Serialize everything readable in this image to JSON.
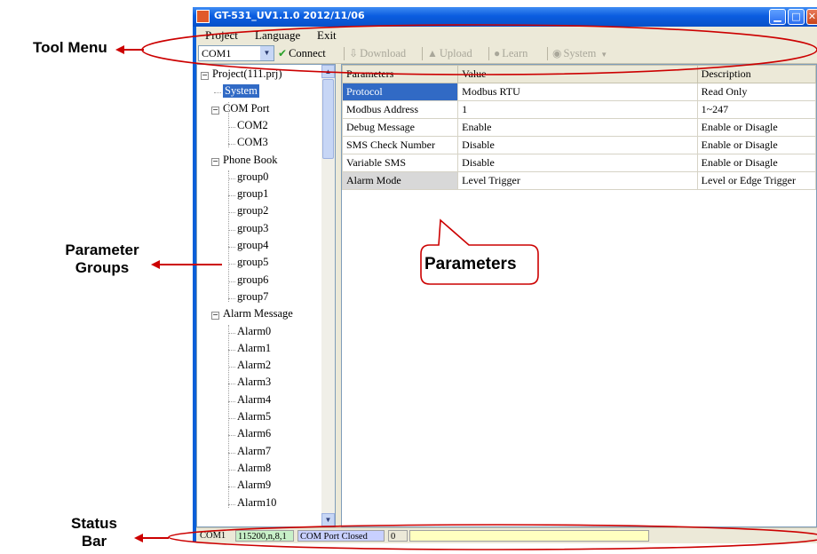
{
  "annotations": {
    "tool_menu": "Tool Menu",
    "parameter_groups": [
      "Parameter",
      "Groups"
    ],
    "status_bar": [
      "Status",
      "Bar"
    ],
    "parameters": "Parameters"
  },
  "window": {
    "title": "GT-531_UV1.1.0 2012/11/06"
  },
  "menu": [
    "Project",
    "Language",
    "Exit"
  ],
  "toolbar": {
    "com_port": "COM1",
    "connect": "Connect",
    "download": "Download",
    "upload": "Upload",
    "learn": "Learn",
    "system": "System"
  },
  "tree": [
    {
      "label": "Project(111.prj)",
      "level": 0,
      "expander": "minus"
    },
    {
      "label": "System",
      "level": 1,
      "selected": true
    },
    {
      "label": "COM Port",
      "level": 1,
      "expander": "minus"
    },
    {
      "label": "COM2",
      "level": 2
    },
    {
      "label": "COM3",
      "level": 2
    },
    {
      "label": "Phone Book",
      "level": 1,
      "expander": "minus"
    },
    {
      "label": "group0",
      "level": 2
    },
    {
      "label": "group1",
      "level": 2
    },
    {
      "label": "group2",
      "level": 2
    },
    {
      "label": "group3",
      "level": 2
    },
    {
      "label": "group4",
      "level": 2
    },
    {
      "label": "group5",
      "level": 2
    },
    {
      "label": "group6",
      "level": 2
    },
    {
      "label": "group7",
      "level": 2
    },
    {
      "label": "Alarm Message",
      "level": 1,
      "expander": "minus"
    },
    {
      "label": "Alarm0",
      "level": 2
    },
    {
      "label": "Alarm1",
      "level": 2
    },
    {
      "label": "Alarm2",
      "level": 2
    },
    {
      "label": "Alarm3",
      "level": 2
    },
    {
      "label": "Alarm4",
      "level": 2
    },
    {
      "label": "Alarm5",
      "level": 2
    },
    {
      "label": "Alarm6",
      "level": 2
    },
    {
      "label": "Alarm7",
      "level": 2
    },
    {
      "label": "Alarm8",
      "level": 2
    },
    {
      "label": "Alarm9",
      "level": 2
    },
    {
      "label": "Alarm10",
      "level": 2
    }
  ],
  "grid": {
    "headers": [
      "Parameters",
      "Value",
      "Description"
    ],
    "rows": [
      {
        "param": "Protocol",
        "value": "Modbus RTU",
        "desc": "Read Only",
        "style": "sel"
      },
      {
        "param": "Modbus Address",
        "value": "1",
        "desc": "1~247",
        "style": ""
      },
      {
        "param": "Debug Message",
        "value": "Enable",
        "desc": "Enable or Disagle",
        "style": ""
      },
      {
        "param": "SMS Check Number",
        "value": "Disable",
        "desc": "Enable or Disagle",
        "style": ""
      },
      {
        "param": "Variable SMS",
        "value": "Disable",
        "desc": "Enable or Disagle",
        "style": ""
      },
      {
        "param": "Alarm Mode",
        "value": "Level Trigger",
        "desc": "Level or Edge Trigger",
        "style": "gray"
      }
    ]
  },
  "statusbar": {
    "port": "COM1",
    "settings": "115200,n,8,1",
    "state": "COM Port Closed",
    "count": "0",
    "message": ""
  },
  "colors": {
    "title_bar": "#0b5de0",
    "selection": "#316ac5",
    "settings_cell": "#c8f0c8",
    "state_cell": "#c8d0ff",
    "message_cell": "#ffffc0",
    "annotation_stroke": "#cc0000"
  }
}
